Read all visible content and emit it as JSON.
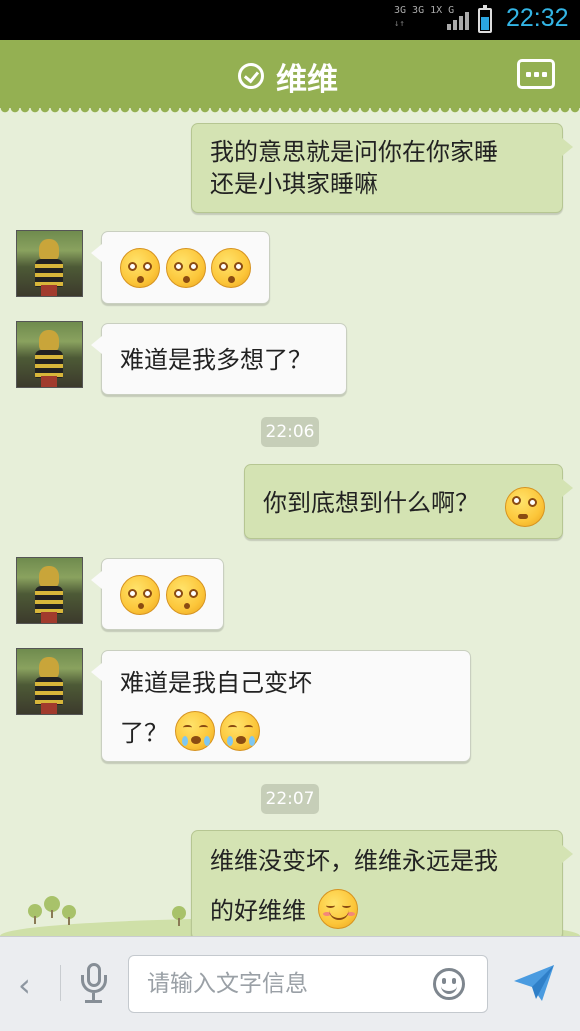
{
  "status_bar": {
    "network_top": "3G 3G 1X  G",
    "network_bottom": "↓↑  ",
    "time": "22:32",
    "battery_level": 0.6
  },
  "header": {
    "title": "维维"
  },
  "messages": [
    {
      "type": "sent",
      "line1": "我的意思就是问你在你家睡",
      "line2": "还是小琪家睡嘛"
    },
    {
      "type": "received",
      "emojis": [
        "dizzy-emoji",
        "dizzy-emoji",
        "dizzy-emoji"
      ]
    },
    {
      "type": "received",
      "line1": "难道是我多想了？"
    },
    {
      "type": "timestamp",
      "text": "22:06"
    },
    {
      "type": "sent",
      "line1": "你到底想到什么啊？",
      "emojis": [
        "confused-emoji"
      ]
    },
    {
      "type": "received",
      "emojis": [
        "pleading-emoji",
        "pleading-emoji"
      ]
    },
    {
      "type": "received",
      "line1": "难道是我自己变坏",
      "line2": "了？",
      "emojis": [
        "crying-emoji",
        "crying-emoji"
      ]
    },
    {
      "type": "timestamp",
      "text": "22:07"
    },
    {
      "type": "sent",
      "line1": "维维没变坏，维维永远是我",
      "line2": "的好维维",
      "emojis": [
        "blushing-smile-emoji"
      ]
    }
  ],
  "input_bar": {
    "placeholder": "请输入文字信息",
    "value": ""
  },
  "colors": {
    "header": "#94b052",
    "background": "#e7efd9",
    "sent_bubble": "#d4e3b3",
    "received_bubble": "#fafafa",
    "clock": "#33b5e5"
  }
}
